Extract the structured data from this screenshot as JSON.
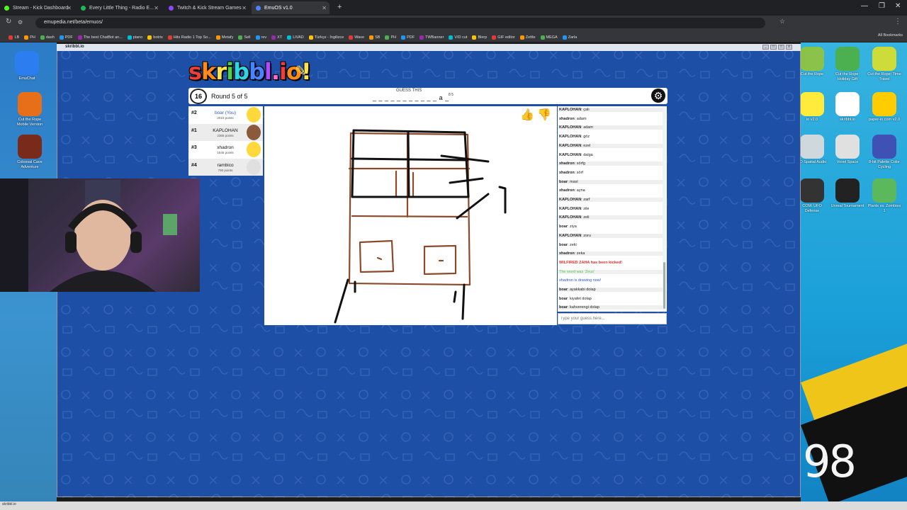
{
  "browser": {
    "tabs": [
      {
        "title": "Stream - Kick Dashboard"
      },
      {
        "title": "Every Little Thing - Radio E..."
      },
      {
        "title": "Twitch & Kick Stream Games"
      },
      {
        "title": "EmuOS v1.0"
      }
    ],
    "new_tab": "+",
    "url": "emupedia.net/beta/emuos/",
    "bookmarks": [
      "LB",
      "PH",
      "dash",
      "PDF",
      "The best ChatBot an...",
      "piano",
      "botrix",
      "Hits Radio 1 Top So...",
      "Metafy",
      "Sell",
      "rev",
      "XT",
      "LIVAD",
      "Türkçe - İngilizce",
      "Wave",
      "SB",
      "PH",
      "PDF",
      "TWBanner",
      "VID cut",
      "Blerp",
      "GIF editor",
      "Zettle",
      "MEGA",
      "Zarla"
    ],
    "all_bookmarks": "All Bookmarks"
  },
  "desktop": {
    "left_icons": [
      {
        "label": "EmuChat",
        "color": "#2b7df0"
      },
      {
        "label": "Cut the Rope Mobile Version",
        "color": "#e86f1a"
      },
      {
        "label": "Colossal Cave Adventure",
        "color": "#7a2a1a"
      }
    ],
    "right_icons": [
      {
        "label": "Cut the Rope",
        "color": "#8bc34a"
      },
      {
        "label": "Cut the Rope: Holiday Gift",
        "color": "#4caf50"
      },
      {
        "label": "Cut the Rope: Time Travel",
        "color": "#cddc39"
      },
      {
        "label": "io v2.0",
        "color": "#ffeb3b"
      },
      {
        "label": "skribbl.io",
        "color": "#ffffff"
      },
      {
        "label": "paper-io.com v2.0",
        "color": "#ffcc00"
      },
      {
        "label": "3D Spatial Audio",
        "color": "#cfd8dc"
      },
      {
        "label": "Voxel Space",
        "color": "#e0e0e0"
      },
      {
        "label": "8-bit Palette Color Cycling",
        "color": "#3f51b5"
      },
      {
        "label": "COM: UFO Defense",
        "color": "#333333"
      },
      {
        "label": "Unreal Tournament",
        "color": "#222222"
      },
      {
        "label": "Plants vs. Zombies 1",
        "color": "#5cb85c"
      }
    ],
    "clock_text": "98",
    "taskbar_item": "skribbl.io"
  },
  "window": {
    "title": "skribbl.io",
    "buttons": [
      "_",
      "□",
      "x"
    ]
  },
  "game": {
    "logo_letters": [
      "s",
      "k",
      "r",
      "i",
      "b",
      "b",
      "l",
      ".",
      "i",
      "o",
      "!"
    ],
    "timer": "16",
    "round": "Round 5 of 5",
    "guess_label": "GUESS THIS",
    "word_pattern": "_ _ _ _ _ _ _ _   _ _ _ a _",
    "word_lengths": "8 5",
    "settings_icon": "gear-icon",
    "players": [
      {
        "rank": "#2",
        "name": "boar (You)",
        "points": "2010 points",
        "you": true,
        "avatar_color": "#ffd83b"
      },
      {
        "rank": "#1",
        "name": "KAPLOHAN",
        "points": "2365 points",
        "you": false,
        "avatar_color": "#8b5a3c"
      },
      {
        "rank": "#3",
        "name": "xhadron",
        "points": "1545 points",
        "you": false,
        "avatar_color": "#ffd83b"
      },
      {
        "rank": "#4",
        "name": "rambico",
        "points": "790 points",
        "you": false,
        "avatar_color": "#e0e0e0"
      }
    ],
    "chat": [
      {
        "author": "KAPLOHAN",
        "text": "çalı",
        "type": "normal"
      },
      {
        "author": "xhadron",
        "text": "adam",
        "type": "normal"
      },
      {
        "author": "KAPLOHAN",
        "text": "adam",
        "type": "normal"
      },
      {
        "author": "KAPLOHAN",
        "text": "göz",
        "type": "normal"
      },
      {
        "author": "KAPLOHAN",
        "text": "ezel",
        "type": "normal"
      },
      {
        "author": "KAPLOHAN",
        "text": "dalga",
        "type": "normal"
      },
      {
        "author": "xhadron",
        "text": "sörfg",
        "type": "normal"
      },
      {
        "author": "xhadron",
        "text": "sörf",
        "type": "normal"
      },
      {
        "author": "boar",
        "text": "mavi",
        "type": "normal"
      },
      {
        "author": "xhadron",
        "text": "ayna",
        "type": "normal"
      },
      {
        "author": "KAPLOHAN",
        "text": "zarf",
        "type": "normal"
      },
      {
        "author": "KAPLOHAN",
        "text": "zile",
        "type": "normal"
      },
      {
        "author": "KAPLOHAN",
        "text": "zeli",
        "type": "normal"
      },
      {
        "author": "boar",
        "text": "ziya",
        "type": "normal"
      },
      {
        "author": "KAPLOHAN",
        "text": "zoru",
        "type": "normal"
      },
      {
        "author": "boar",
        "text": "zeki",
        "type": "normal"
      },
      {
        "author": "xhadron",
        "text": "zeka",
        "type": "normal"
      },
      {
        "author": "",
        "text": "WILFIRED ZAHA has been kicked!",
        "type": "red"
      },
      {
        "author": "",
        "text": "The word was 'Zeus'",
        "type": "green"
      },
      {
        "author": "",
        "text": "xhadron is drawing now!",
        "type": "blue"
      },
      {
        "author": "boar",
        "text": "ayakkabi dolap",
        "type": "normal"
      },
      {
        "author": "boar",
        "text": "kiyafet dolap",
        "type": "normal"
      },
      {
        "author": "boar",
        "text": "kahverengi dolap",
        "type": "normal"
      }
    ],
    "guess_placeholder": "Type your guess here..."
  }
}
